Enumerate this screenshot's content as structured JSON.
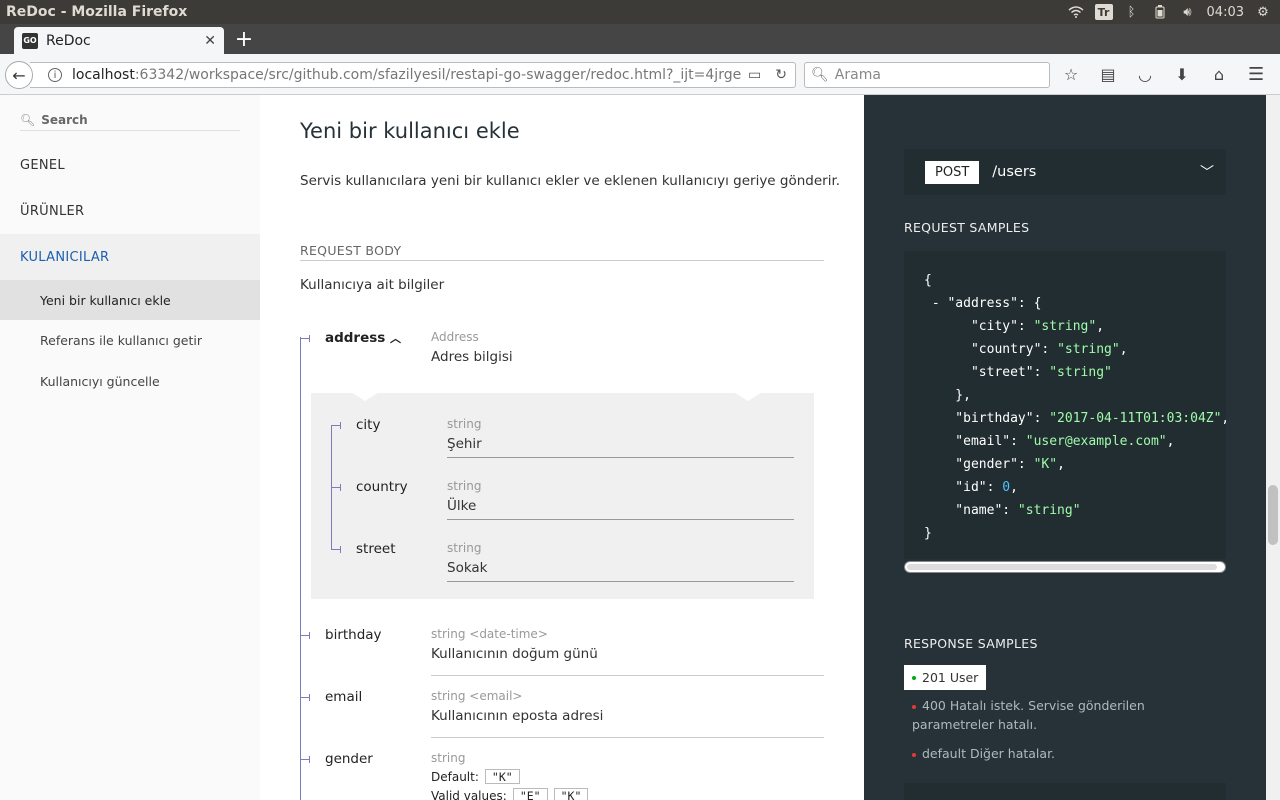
{
  "os": {
    "window_title": "ReDoc - Mozilla Firefox",
    "keyboard_layout": "Tr",
    "clock": "04:03"
  },
  "browser": {
    "tab_title": "ReDoc",
    "favicon_text": "GO",
    "url_host": "localhost",
    "url_rest": ":63342/workspace/src/github.com/sfazilyesil/restapi-go-swagger/redoc.html?_ijt=4jrge",
    "search_placeholder": "Arama"
  },
  "sidebar": {
    "search_placeholder": "Search",
    "items": [
      {
        "label": "GENEL"
      },
      {
        "label": "ÜRÜNLER"
      },
      {
        "label": "KULANICILAR"
      }
    ],
    "sub_items": [
      {
        "label": "Yeni bir kullanıcı ekle"
      },
      {
        "label": "Referans ile kullanıcı getir"
      },
      {
        "label": "Kullanıcıyı güncelle"
      }
    ]
  },
  "operation": {
    "title": "Yeni bir kullanıcı ekle",
    "description": "Servis kullanıcılara yeni bir kullanıcı ekler ve eklenen kullanıcıyı geriye gönderir.",
    "request_body_title": "REQUEST BODY",
    "request_body_desc": "Kullanıcıya ait bilgiler",
    "properties": {
      "address": {
        "name": "address",
        "type": "Address",
        "desc": "Adres bilgisi"
      },
      "city": {
        "name": "city",
        "type": "string",
        "desc": "Şehir"
      },
      "country": {
        "name": "country",
        "type": "string",
        "desc": "Ülke"
      },
      "street": {
        "name": "street",
        "type": "string",
        "desc": "Sokak"
      },
      "birthday": {
        "name": "birthday",
        "type": "string <date-time>",
        "desc": "Kullanıcının doğum günü"
      },
      "email": {
        "name": "email",
        "type": "string <email>",
        "desc": "Kullanıcının eposta adresi"
      },
      "gender": {
        "name": "gender",
        "type": "string",
        "default_label": "Default:",
        "default_value": "\"K\"",
        "valid_label": "Valid values:",
        "valid_values": [
          "\"E\"",
          "\"K\""
        ]
      }
    }
  },
  "right_panel": {
    "method": "POST",
    "path": "/users",
    "request_samples_title": "REQUEST SAMPLES",
    "code": {
      "city": "\"string\"",
      "country": "\"string\"",
      "street": "\"string\"",
      "birthday": "\"2017-04-11T01:03:04Z\"",
      "email": "\"user@example.com\"",
      "gender": "\"K\"",
      "id": "0",
      "name": "\"string\""
    },
    "response_samples_title": "RESPONSE SAMPLES",
    "responses": [
      {
        "label": "201 User"
      },
      {
        "label": "400 Hatalı istek. Servise gönderilen parametreler hatalı."
      },
      {
        "label": "default Diğer hatalar."
      }
    ]
  },
  "colors": {
    "accent": "#1a5fae",
    "dark_panel": "#263238",
    "code_string": "#a0fbaa",
    "code_number": "#4bc4ff"
  }
}
